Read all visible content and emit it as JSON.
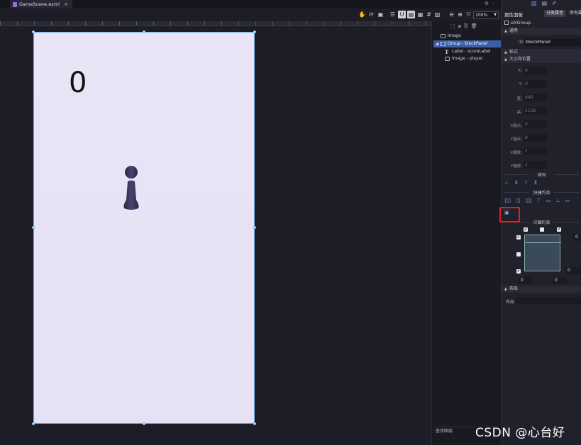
{
  "tab": {
    "filename": "GameScene.exml",
    "close": "×"
  },
  "toolbar": {
    "zoom": "100%"
  },
  "canvas": {
    "score_text": "0"
  },
  "layers": {
    "items": [
      {
        "label": "Image",
        "icon": "image-icon"
      },
      {
        "label": "Group - blockPanel",
        "icon": "group-icon",
        "selected": true
      },
      {
        "label": "Label - scoreLabel",
        "icon": "text-icon"
      },
      {
        "label": "Image - player",
        "icon": "image-icon"
      }
    ],
    "search_placeholder": "查找图层"
  },
  "props": {
    "title": "属性面板",
    "categorized_button": "分类属性",
    "all_button": "所有属性",
    "component_type": "eXGroup",
    "sections": {
      "general": "通用",
      "style": "样式",
      "size_position": "大小和位置",
      "layout": "布局"
    },
    "id_label": "ID:",
    "id_value": "blockPanel",
    "fields": [
      {
        "label": "X:",
        "value": "0"
      },
      {
        "label": "Y:",
        "value": "0"
      },
      {
        "label": "宽:",
        "value": "640"
      },
      {
        "label": "高:",
        "value": "1136"
      },
      {
        "label": "X锚点:",
        "value": "0"
      },
      {
        "label": "Y锚点:",
        "value": "0"
      },
      {
        "label": "X缩放:",
        "value": "1"
      },
      {
        "label": "Y缩放:",
        "value": "1"
      }
    ],
    "arrange_label": "排列",
    "quick_constraint_label": "快捷约束",
    "detail_constraint_label": "详细约束",
    "constraint_values": {
      "right_top": "0",
      "right_bottom": "0",
      "bottom_left": "0",
      "bottom_right": "0"
    },
    "layout_label": "布局"
  },
  "watermark": "CSDN @心台好"
}
